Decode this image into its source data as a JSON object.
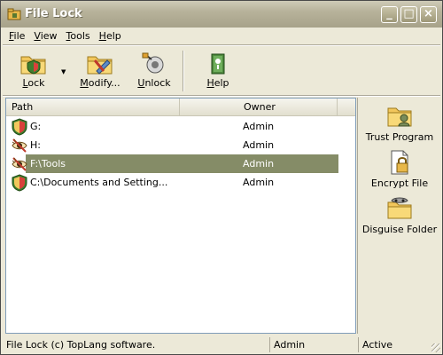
{
  "window": {
    "title": "File Lock",
    "controls": {
      "minimize": "_",
      "maximize": "□",
      "close": "×"
    }
  },
  "menu": [
    {
      "label": "File",
      "mnemonic": "F",
      "rest": "ile"
    },
    {
      "label": "View",
      "mnemonic": "V",
      "rest": "iew"
    },
    {
      "label": "Tools",
      "mnemonic": "T",
      "rest": "ools"
    },
    {
      "label": "Help",
      "mnemonic": "H",
      "rest": "elp"
    }
  ],
  "toolbar": {
    "lock": {
      "mnemonic": "L",
      "rest": "ock",
      "icon": "lock-folder-icon"
    },
    "modify": {
      "mnemonic": "M",
      "rest": "odify...",
      "icon": "modify-folder-icon"
    },
    "unlock": {
      "mnemonic": "U",
      "rest": "nlock",
      "icon": "unlock-icon"
    },
    "help": {
      "mnemonic": "H",
      "rest": "elp",
      "icon": "help-book-icon"
    }
  },
  "list": {
    "columns": [
      "Path",
      "Owner"
    ],
    "rows": [
      {
        "path": "G:",
        "owner": "Admin",
        "icon": "shield-icon",
        "selected": false
      },
      {
        "path": "H:",
        "owner": "Admin",
        "icon": "hidden-eye-icon",
        "selected": false
      },
      {
        "path": "F:\\Tools",
        "owner": "Admin",
        "icon": "hidden-eye-icon",
        "selected": true
      },
      {
        "path": "C:\\Documents and Setting...",
        "owner": "Admin",
        "icon": "shield-icon",
        "selected": false
      }
    ]
  },
  "side": {
    "trust": "Trust Program",
    "encrypt": "Encrypt File",
    "disguise": "Disguise Folder"
  },
  "status": {
    "info": "File Lock (c) TopLang software.",
    "user": "Admin",
    "state": "Active"
  },
  "colors": {
    "selection": "#858C67",
    "titlebar": "#B7B29A",
    "window_bg": "#ECE9D8"
  }
}
